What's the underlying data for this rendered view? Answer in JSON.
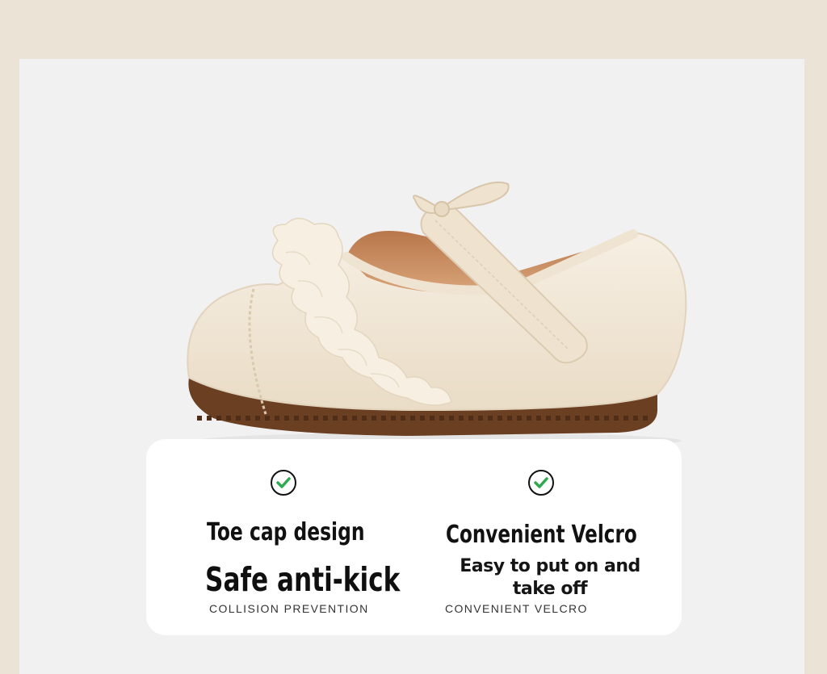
{
  "features": [
    {
      "title": "Toe cap design",
      "headline": "Safe anti-kick",
      "subtitle": "COLLISION PREVENTION",
      "icon": "check-circle-icon"
    },
    {
      "title": "Convenient Velcro",
      "description": "Easy to put on and take off",
      "subtitle": "CONVENIENT VELCRO",
      "icon": "check-circle-icon"
    }
  ],
  "colors": {
    "background": "#ebe3d6",
    "panel": "#f1f1f1",
    "card": "#ffffff",
    "check_green": "#2fa84f",
    "shoe_leather": "#f2e8d9",
    "sole": "#6b3f22"
  }
}
